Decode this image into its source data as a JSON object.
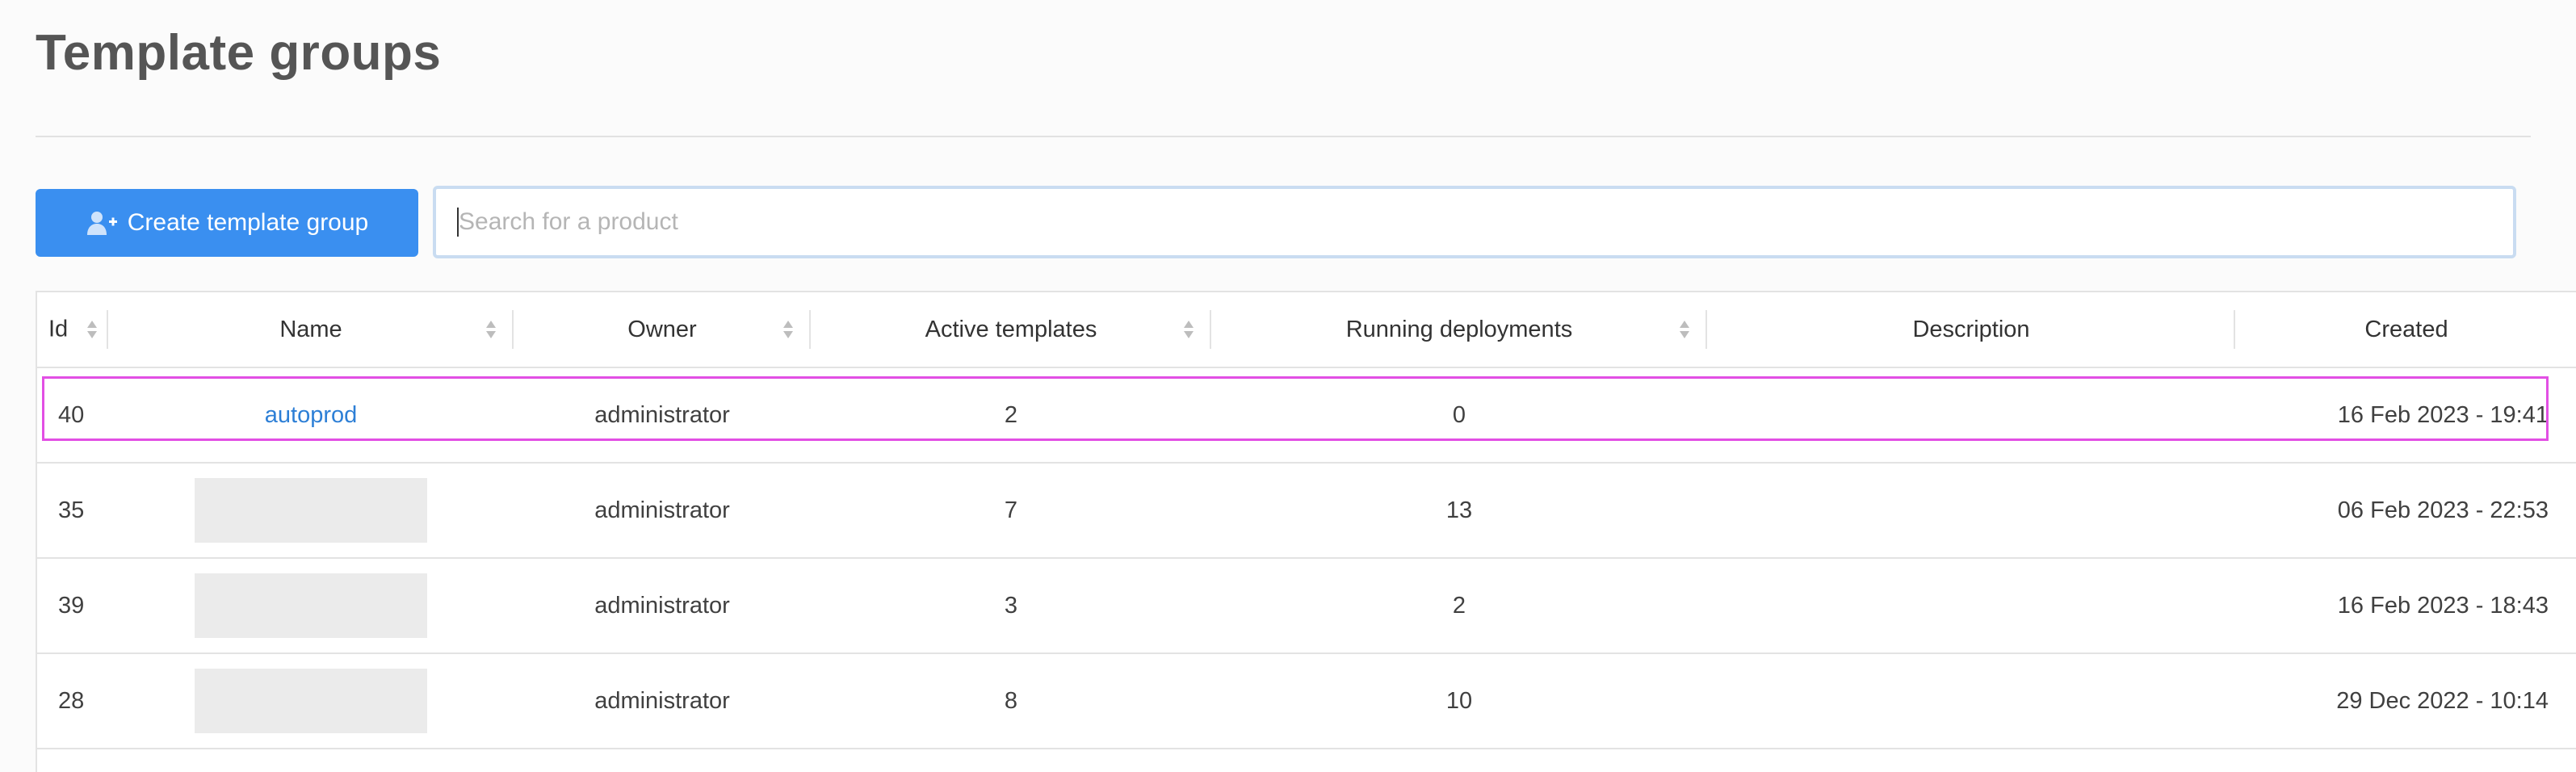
{
  "page": {
    "title": "Template groups"
  },
  "toolbar": {
    "create_label": "Create template group",
    "create_icon": "add-user-icon",
    "accent_color": "#3a8ff0"
  },
  "search": {
    "value": "",
    "placeholder": "Search for a product"
  },
  "table": {
    "columns": [
      "Id",
      "Name",
      "Owner",
      "Active templates",
      "Running deployments",
      "Description",
      "Created"
    ],
    "rows": [
      {
        "id": "40",
        "name": "autoprod",
        "owner": "administrator",
        "active": "2",
        "running": "0",
        "description": "",
        "created": "16 Feb 2023 - 19:41"
      },
      {
        "id": "35",
        "name": "",
        "owner": "administrator",
        "active": "7",
        "running": "13",
        "description": "",
        "created": "06 Feb 2023 - 22:53"
      },
      {
        "id": "39",
        "name": "",
        "owner": "administrator",
        "active": "3",
        "running": "2",
        "description": "",
        "created": "16 Feb 2023 - 18:43"
      },
      {
        "id": "28",
        "name": "",
        "owner": "administrator",
        "active": "8",
        "running": "10",
        "description": "",
        "created": "29 Dec 2022 - 10:14"
      }
    ]
  },
  "highlight_color": "#e24fe4"
}
